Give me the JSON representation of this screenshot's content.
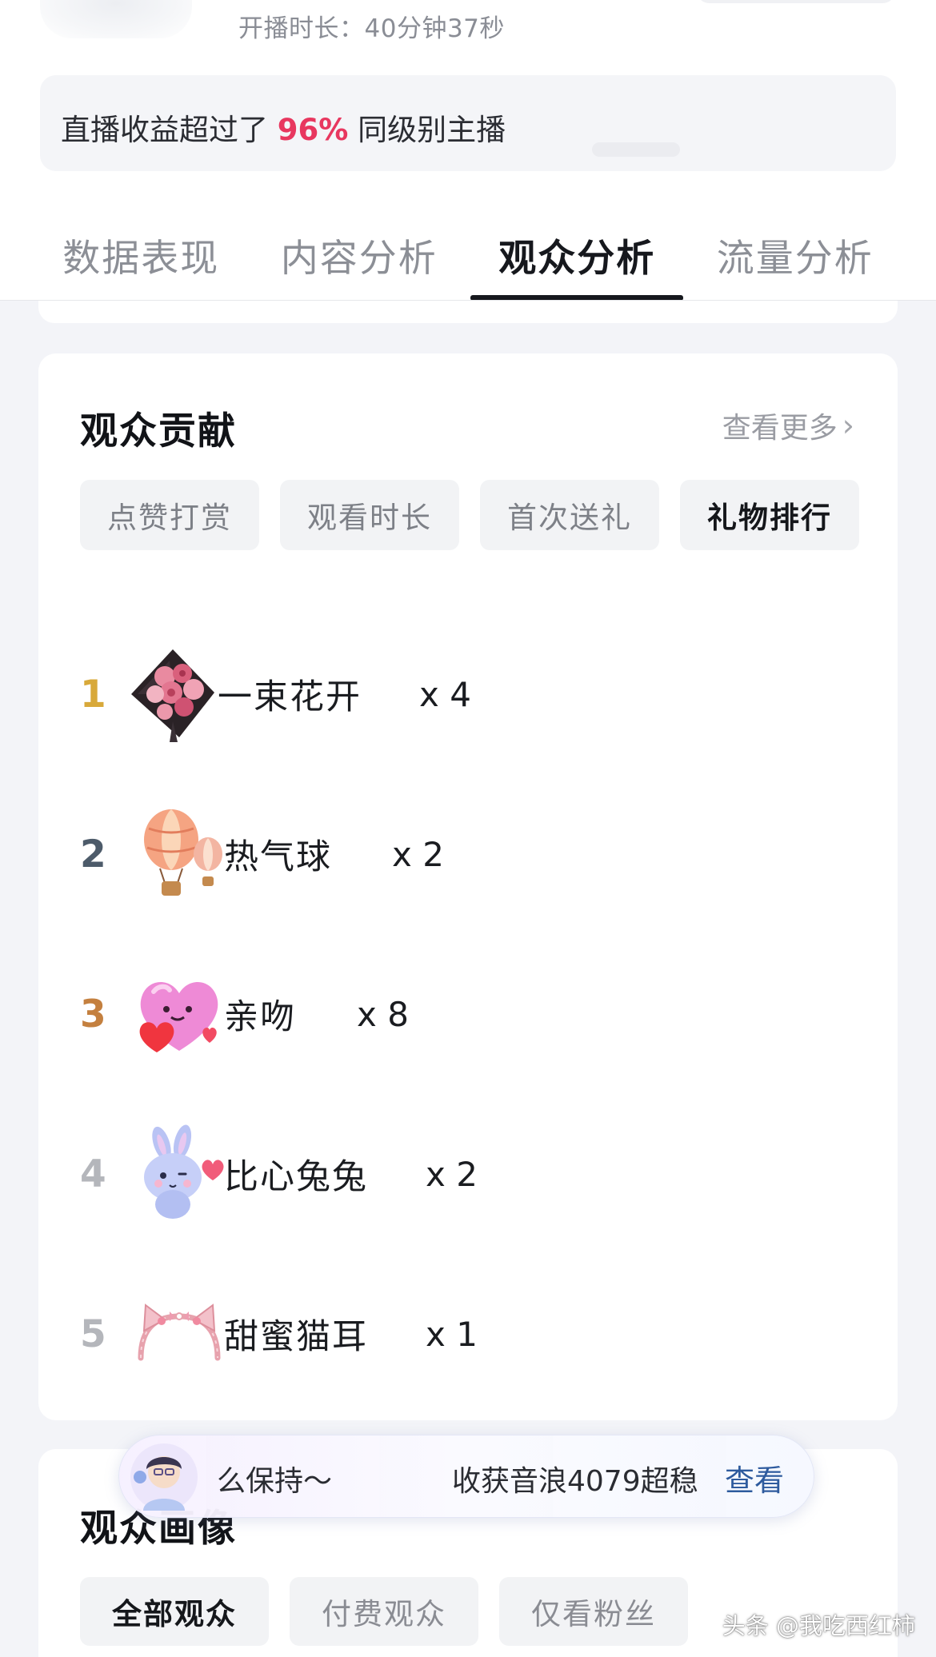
{
  "header": {
    "duration_label": "开播时长：40分钟37秒"
  },
  "banner": {
    "prefix": "直播收益超过了",
    "percent": "96%",
    "suffix": "同级别主播"
  },
  "tabs": [
    {
      "label": "数据表现",
      "active": false
    },
    {
      "label": "内容分析",
      "active": false
    },
    {
      "label": "观众分析",
      "active": true
    },
    {
      "label": "流量分析",
      "active": false
    }
  ],
  "contribution": {
    "title": "观众贡献",
    "more_label": "查看更多",
    "chips": [
      {
        "label": "点赞打赏",
        "active": false
      },
      {
        "label": "观看时长",
        "active": false
      },
      {
        "label": "首次送礼",
        "active": false
      },
      {
        "label": "礼物排行",
        "active": true
      }
    ],
    "ranking": [
      {
        "rank": "1",
        "icon": "bouquet-icon",
        "name": "一束花开",
        "count": "x 4"
      },
      {
        "rank": "2",
        "icon": "hot-air-balloon-icon",
        "name": "热气球",
        "count": "x 2"
      },
      {
        "rank": "3",
        "icon": "kiss-heart-icon",
        "name": "亲吻",
        "count": "x 8"
      },
      {
        "rank": "4",
        "icon": "heart-bunny-icon",
        "name": "比心兔兔",
        "count": "x 2"
      },
      {
        "rank": "5",
        "icon": "cat-ears-headband-icon",
        "name": "甜蜜猫耳",
        "count": "x 1"
      }
    ]
  },
  "portrait": {
    "title": "观众画像",
    "chips": [
      {
        "label": "全部观众",
        "active": true
      },
      {
        "label": "付费观众",
        "active": false
      },
      {
        "label": "仅看粉丝",
        "active": false
      }
    ]
  },
  "toast": {
    "left_text": "么保持～",
    "mid_text": "收获音浪4079超稳",
    "action_label": "查看"
  },
  "watermark": "头条 @我吃西红柿",
  "colors": {
    "highlight": "#e8375f",
    "rank1": "#d8a93a",
    "rank2": "#4d5b6a",
    "rank3": "#c4803f",
    "rank_other": "#b4b6bb",
    "link": "#2e5b9e"
  }
}
